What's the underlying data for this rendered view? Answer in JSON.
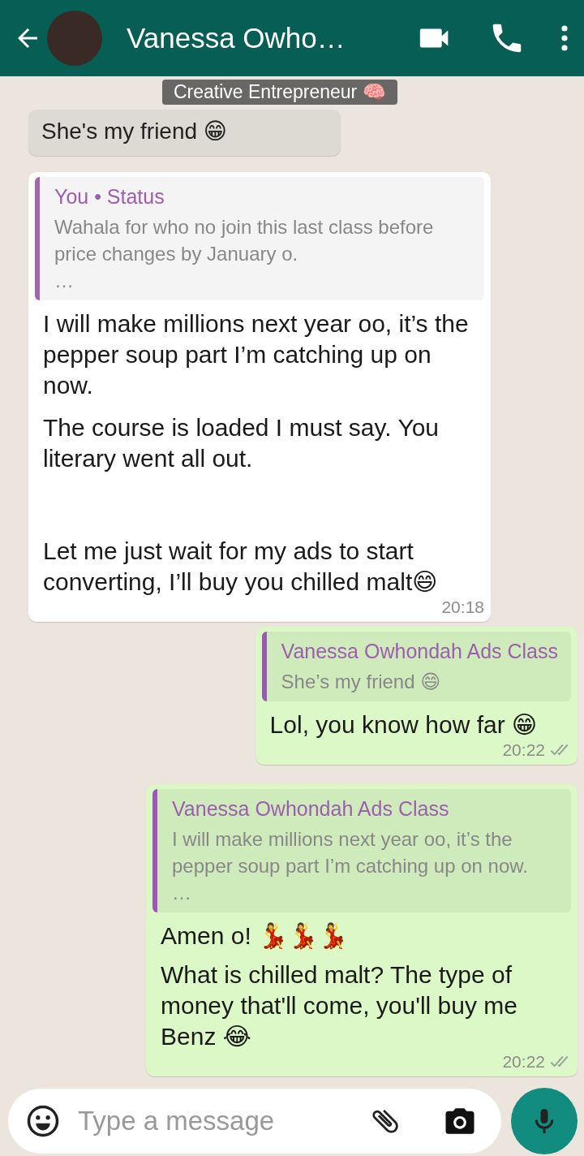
{
  "header": {
    "contact_name": "Vanessa Owho…",
    "subtitle": "Creative Entrepreneur 🧠"
  },
  "messages": [
    {
      "kind": "incoming",
      "text": "She's my friend 😁"
    },
    {
      "kind": "incoming",
      "quote": {
        "author": "You • Status",
        "text": "Wahala for who no join this last class before price changes by January o.\n…"
      },
      "paragraphs": [
        "I will make millions next year oo, it’s the pepper soup part I’m catching up on now.",
        "The course is loaded I must say. You literary went all out.",
        "Let me just wait for my ads to start converting, I’ll buy you chilled malt😄"
      ],
      "time": "20:18"
    },
    {
      "kind": "outgoing",
      "quote": {
        "author": "Vanessa Owhondah Ads Class",
        "text": "She’s my friend 😄"
      },
      "paragraphs": [
        "Lol, you know how far 😁"
      ],
      "time": "20:22",
      "read": false
    },
    {
      "kind": "outgoing",
      "quote": {
        "author": "Vanessa Owhondah Ads Class",
        "text": "I will make millions next year oo, it’s the pepper soup part I’m catching up on now.\n…"
      },
      "paragraphs": [
        "Amen o! 💃💃💃",
        "What is chilled malt? The type of money that'll come, you'll buy me Benz 😂"
      ],
      "time": "20:22",
      "read": false
    }
  ],
  "composer": {
    "placeholder": "Type a message"
  }
}
